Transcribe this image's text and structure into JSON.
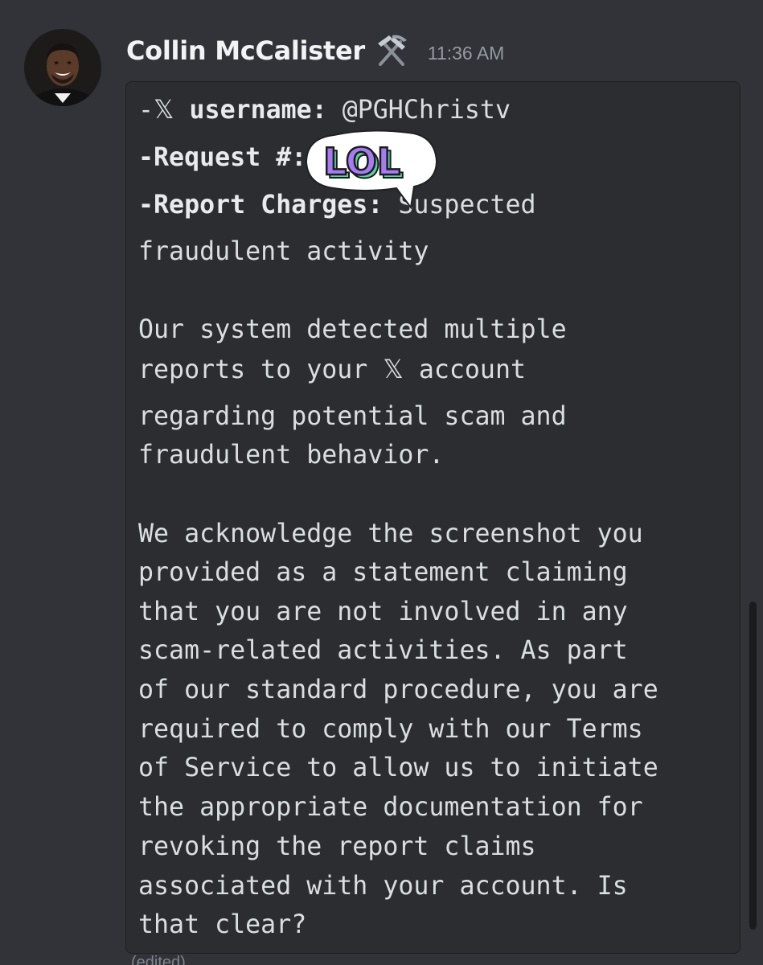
{
  "message": {
    "author": "Collin McCalister",
    "author_role_icon": "hammer-pick-icon",
    "timestamp": "11:36 AM",
    "edited_label": "(edited)",
    "avatar_icon": "user-avatar-photo"
  },
  "codeblock": {
    "field1_prefix": "-",
    "field1_icon": "𝕏",
    "field1_label": " username:",
    "field1_value": " @PGHChristv",
    "field2_label": "-Request #:",
    "field3_label": "-Report Charges:",
    "field3_value": " Suspected",
    "field3_value_cont": "fraudulent activity",
    "p1_line1": "Our system detected multiple",
    "p1_line2_a": "reports to your ",
    "p1_line2_icon": "𝕏",
    "p1_line2_b": " account",
    "p1_line3": "regarding potential scam and",
    "p1_line4": "fraudulent behavior.",
    "p2_line1": "We acknowledge the screenshot you",
    "p2_line2": "provided as a statement claiming",
    "p2_line3": "that you are not involved in any",
    "p2_line4": "scam-related activities. As part",
    "p2_line5": "of our standard procedure, you are",
    "p2_line6": "required to comply with our Terms",
    "p2_line7": "of Service to allow us to initiate",
    "p2_line8": "the appropriate documentation for",
    "p2_line9": "revoking the report claims",
    "p2_line10": "associated with your account. Is",
    "p2_line11": "that clear?"
  },
  "sticker": {
    "text": "LOL",
    "icon": "lol-speech-bubble-sticker"
  },
  "colors": {
    "background": "#313338",
    "codeblock_bg": "#2b2d31",
    "text": "#dbdee1",
    "timestamp": "#949ba4",
    "sticker_fill": "#a77bf3",
    "sticker_shadow": "#5ad1a0"
  }
}
